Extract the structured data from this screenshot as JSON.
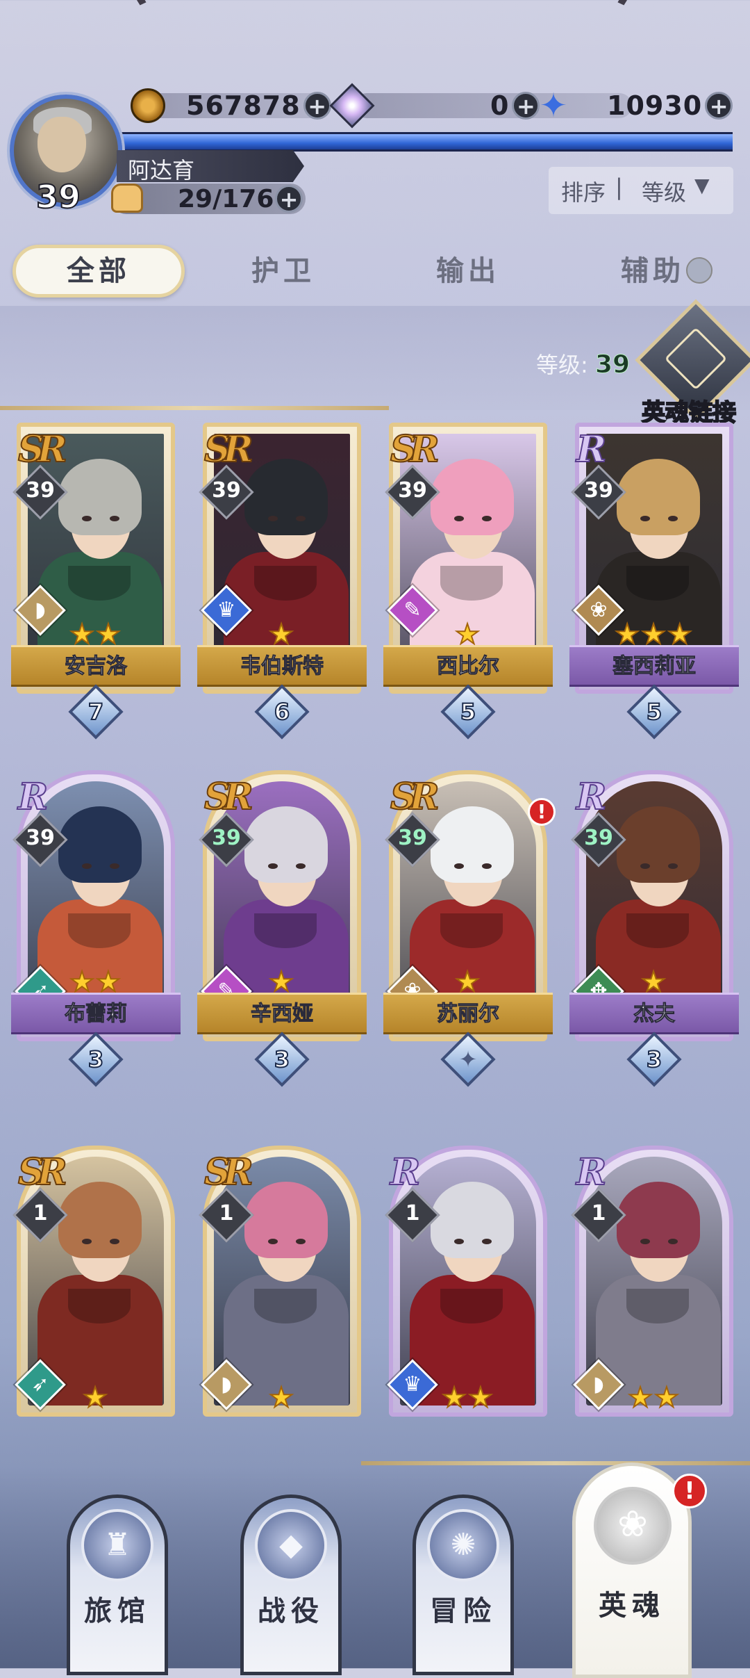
{
  "player": {
    "name": "阿达育",
    "level": "39",
    "stamina": "29/176"
  },
  "resources": [
    {
      "icon": "gold-coin-icon",
      "value": "567878"
    },
    {
      "icon": "gem-icon",
      "value": "0"
    },
    {
      "icon": "blue-star-icon",
      "value": "10930"
    }
  ],
  "sort": {
    "label": "排序",
    "divider": "|",
    "value": "等级",
    "arrow": "▼"
  },
  "tabs": [
    "全部",
    "护卫",
    "输出",
    "辅助"
  ],
  "level_info": {
    "label": "等级:",
    "value": "39"
  },
  "soul_link_label": "英魂链接",
  "plus_symbol": "+",
  "alert_symbol": "!",
  "heroes": [
    {
      "name": "安吉洛",
      "rarity": "SR",
      "level": "39",
      "stars": "★★",
      "soul": "7",
      "role": "guardian"
    },
    {
      "name": "韦伯斯特",
      "rarity": "SR",
      "level": "39",
      "stars": "★",
      "soul": "6",
      "role": "support"
    },
    {
      "name": "西比尔",
      "rarity": "SR",
      "level": "39",
      "stars": "★",
      "soul": "5",
      "role": "mage"
    },
    {
      "name": "塞西莉亚",
      "rarity": "R",
      "level": "39",
      "stars": "★★★",
      "soul": "5",
      "role": "rose"
    },
    {
      "name": "布蕾莉",
      "rarity": "R",
      "level": "39",
      "stars": "★★",
      "soul": "3",
      "role": "archer"
    },
    {
      "name": "辛西娅",
      "rarity": "SR",
      "level": "39",
      "stars": "★",
      "soul": "3",
      "role": "mage"
    },
    {
      "name": "苏丽尔",
      "rarity": "SR",
      "level": "39",
      "stars": "★",
      "soul": "",
      "role": "rose"
    },
    {
      "name": "杰夫",
      "rarity": "R",
      "level": "39",
      "stars": "★",
      "soul": "3",
      "role": "ranger"
    },
    {
      "name": "",
      "rarity": "SR",
      "level": "1",
      "stars": "★",
      "soul": "",
      "role": "archer"
    },
    {
      "name": "",
      "rarity": "SR",
      "level": "1",
      "stars": "★",
      "soul": "",
      "role": "guardian"
    },
    {
      "name": "",
      "rarity": "R",
      "level": "1",
      "stars": "★★",
      "soul": "",
      "role": "support"
    },
    {
      "name": "",
      "rarity": "R",
      "level": "1",
      "stars": "★★",
      "soul": "",
      "role": "guardian"
    }
  ],
  "nav": [
    {
      "label": "旅馆",
      "icon": "tavern-mug-icon",
      "glyph": "♜"
    },
    {
      "label": "战役",
      "icon": "campaign-banner-icon",
      "glyph": "◆"
    },
    {
      "label": "冒险",
      "icon": "adventure-compass-icon",
      "glyph": "✺"
    },
    {
      "label": "英魂",
      "icon": "hero-soul-rose-icon",
      "glyph": "❀"
    }
  ],
  "colors": {
    "gold_frame": "#e4c889",
    "purple_frame": "#c1a6de",
    "alert": "#d62424",
    "xp_bar": "#3066d6"
  }
}
